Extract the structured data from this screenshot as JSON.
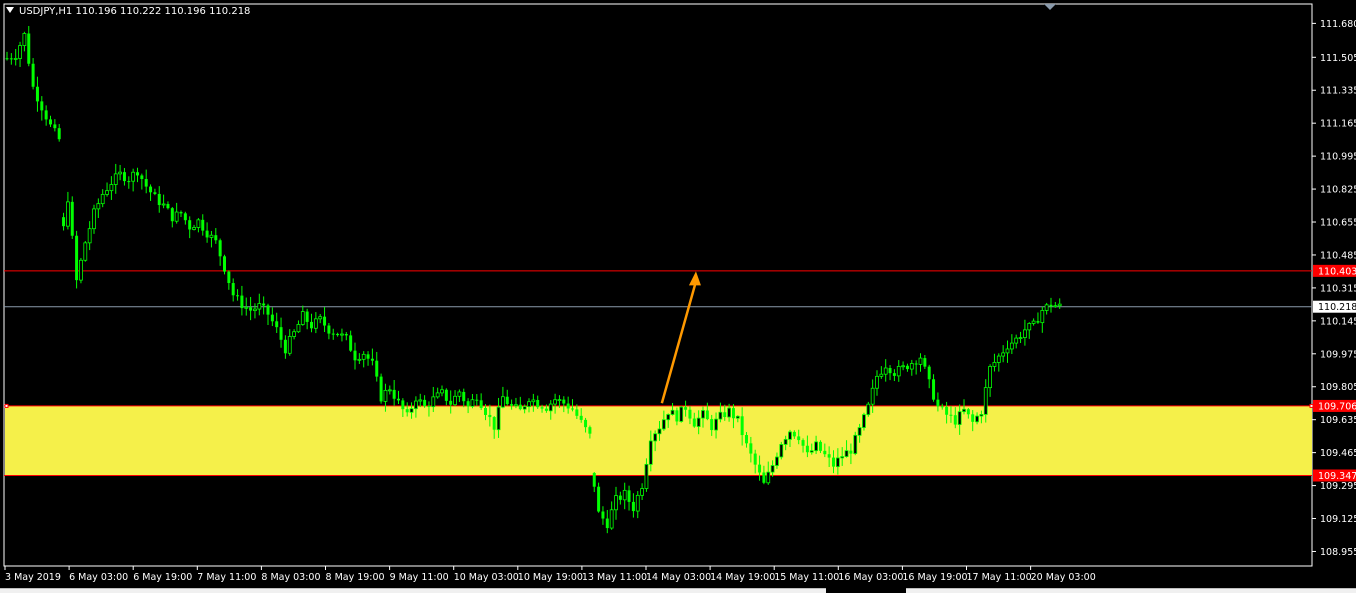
{
  "window": {
    "symbol_line": "USDJPY,H1  110.196 110.222 110.196 110.218"
  },
  "colors": {
    "background": "#000000",
    "bull": "#00ff00",
    "bear": "#00ff00",
    "axis_text": "#ffffff",
    "frame": "#ffffff",
    "resistance_line": "#ff0000",
    "bid_line": "#8a9aab",
    "zone_fill": "#f5f04a",
    "zone_border": "#ff0000",
    "arrow": "#ff9900",
    "price_tag_red": "#ff0000",
    "price_tag_current": "#ffffff"
  },
  "chart_data": {
    "type": "candlestick",
    "instrument": "USDJPY",
    "timeframe": "H1",
    "ylim": [
      108.88,
      111.78
    ],
    "y_ticks": [
      "111.680",
      "111.505",
      "111.335",
      "111.165",
      "110.995",
      "110.825",
      "110.655",
      "110.485",
      "110.315",
      "110.145",
      "109.975",
      "109.805",
      "109.635",
      "109.465",
      "109.295",
      "109.125",
      "108.955"
    ],
    "x_labels": [
      "3 May 2019",
      "6 May 03:00",
      "6 May 19:00",
      "7 May 11:00",
      "8 May 03:00",
      "8 May 19:00",
      "9 May 11:00",
      "10 May 03:00",
      "10 May 19:00",
      "13 May 11:00",
      "14 May 03:00",
      "14 May 19:00",
      "15 May 11:00",
      "16 May 03:00",
      "16 May 19:00",
      "17 May 11:00",
      "20 May 03:00"
    ],
    "levels": [
      {
        "name": "resistance",
        "price": 110.403,
        "label": "110.403",
        "color": "#ff0000"
      },
      {
        "name": "current",
        "price": 110.218,
        "label": "110.218",
        "color": "#ffffff"
      },
      {
        "name": "zone-top",
        "price": 109.706,
        "label": "109.706",
        "color": "#ff0000"
      },
      {
        "name": "zone-bottom",
        "price": 109.347,
        "label": "109.347",
        "color": "#ff0000"
      }
    ],
    "zone": {
      "from": 109.347,
      "to": 109.706
    },
    "arrow": {
      "from_bar": 151,
      "from_price": 109.72,
      "to_bar": 157,
      "to_price": 110.4
    },
    "close_path": [
      [
        0,
        111.5
      ],
      [
        2,
        111.52
      ],
      [
        4,
        111.62
      ],
      [
        6,
        111.35
      ],
      [
        8,
        111.25
      ],
      [
        10,
        111.15
      ],
      [
        12,
        111.08
      ],
      [
        13,
        110.62
      ],
      [
        14,
        110.78
      ],
      [
        16,
        110.35
      ],
      [
        18,
        110.55
      ],
      [
        20,
        110.7
      ],
      [
        22,
        110.8
      ],
      [
        24,
        110.86
      ],
      [
        26,
        110.9
      ],
      [
        28,
        110.88
      ],
      [
        30,
        110.92
      ],
      [
        32,
        110.84
      ],
      [
        34,
        110.78
      ],
      [
        36,
        110.74
      ],
      [
        38,
        110.68
      ],
      [
        40,
        110.7
      ],
      [
        42,
        110.63
      ],
      [
        44,
        110.66
      ],
      [
        46,
        110.6
      ],
      [
        48,
        110.55
      ],
      [
        50,
        110.42
      ],
      [
        52,
        110.28
      ],
      [
        54,
        110.23
      ],
      [
        56,
        110.2
      ],
      [
        58,
        110.22
      ],
      [
        60,
        110.18
      ],
      [
        62,
        110.1
      ],
      [
        64,
        110.0
      ],
      [
        66,
        110.08
      ],
      [
        68,
        110.17
      ],
      [
        70,
        110.12
      ],
      [
        72,
        110.15
      ],
      [
        74,
        110.1
      ],
      [
        76,
        110.08
      ],
      [
        78,
        110.05
      ],
      [
        80,
        109.96
      ],
      [
        82,
        109.98
      ],
      [
        84,
        109.92
      ],
      [
        86,
        109.75
      ],
      [
        88,
        109.8
      ],
      [
        90,
        109.72
      ],
      [
        92,
        109.65
      ],
      [
        94,
        109.75
      ],
      [
        96,
        109.7
      ],
      [
        98,
        109.74
      ],
      [
        100,
        109.77
      ],
      [
        102,
        109.72
      ],
      [
        104,
        109.78
      ],
      [
        106,
        109.7
      ],
      [
        108,
        109.76
      ],
      [
        110,
        109.68
      ],
      [
        112,
        109.6
      ],
      [
        114,
        109.75
      ],
      [
        116,
        109.7
      ],
      [
        118,
        109.68
      ],
      [
        120,
        109.75
      ],
      [
        122,
        109.72
      ],
      [
        124,
        109.7
      ],
      [
        126,
        109.74
      ],
      [
        128,
        109.72
      ],
      [
        130,
        109.69
      ],
      [
        132,
        109.62
      ],
      [
        134,
        109.55
      ],
      [
        135,
        109.3
      ],
      [
        136,
        109.15
      ],
      [
        138,
        109.1
      ],
      [
        140,
        109.22
      ],
      [
        142,
        109.25
      ],
      [
        144,
        109.18
      ],
      [
        146,
        109.3
      ],
      [
        148,
        109.55
      ],
      [
        150,
        109.6
      ],
      [
        152,
        109.68
      ],
      [
        154,
        109.65
      ],
      [
        156,
        109.7
      ],
      [
        158,
        109.62
      ],
      [
        160,
        109.66
      ],
      [
        162,
        109.6
      ],
      [
        164,
        109.65
      ],
      [
        166,
        109.68
      ],
      [
        168,
        109.63
      ],
      [
        170,
        109.5
      ],
      [
        172,
        109.4
      ],
      [
        174,
        109.3
      ],
      [
        176,
        109.4
      ],
      [
        178,
        109.52
      ],
      [
        180,
        109.58
      ],
      [
        182,
        109.55
      ],
      [
        184,
        109.45
      ],
      [
        186,
        109.5
      ],
      [
        188,
        109.45
      ],
      [
        190,
        109.4
      ],
      [
        192,
        109.45
      ],
      [
        194,
        109.48
      ],
      [
        196,
        109.58
      ],
      [
        198,
        109.7
      ],
      [
        200,
        109.86
      ],
      [
        202,
        109.92
      ],
      [
        204,
        109.88
      ],
      [
        206,
        109.9
      ],
      [
        208,
        109.93
      ],
      [
        210,
        109.96
      ],
      [
        212,
        109.82
      ],
      [
        214,
        109.7
      ],
      [
        216,
        109.66
      ],
      [
        218,
        109.63
      ],
      [
        220,
        109.68
      ],
      [
        222,
        109.62
      ],
      [
        224,
        109.68
      ],
      [
        226,
        109.9
      ],
      [
        228,
        109.96
      ],
      [
        230,
        110.02
      ],
      [
        232,
        110.05
      ],
      [
        234,
        110.1
      ],
      [
        236,
        110.12
      ],
      [
        238,
        110.2
      ],
      [
        240,
        110.23
      ],
      [
        242,
        110.218
      ]
    ]
  }
}
